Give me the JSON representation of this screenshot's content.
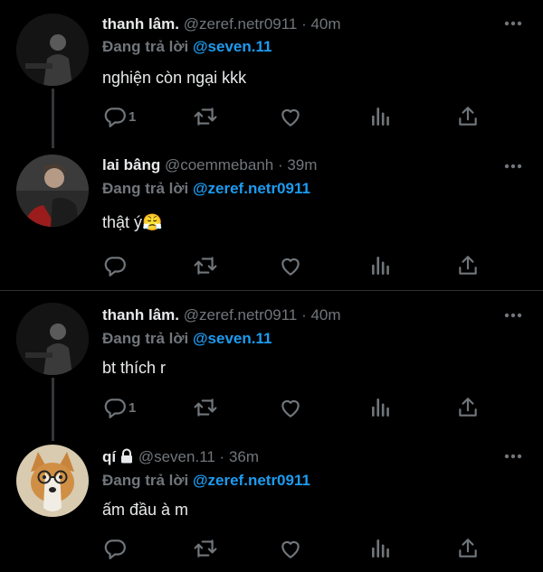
{
  "colors": {
    "background": "#000000",
    "text": "#e7e9ea",
    "muted": "#71767b",
    "accent": "#1d9bf0"
  },
  "reply_prefix": "Đang trả lời",
  "tweets": [
    {
      "name": "thanh lâm.",
      "handle": "@zeref.netr0911 · 40m",
      "reply_to": "@seven.11",
      "text": "nghiện còn ngại kkk",
      "reply_count": "1"
    },
    {
      "name": "lai bâng",
      "handle": "@coemmebanh · 39m",
      "reply_to": "@zeref.netr0911",
      "text": "thật ý😤",
      "reply_count": ""
    },
    {
      "name": "thanh lâm.",
      "handle": "@zeref.netr0911 · 40m",
      "reply_to": "@seven.11",
      "text": "bt thích r",
      "reply_count": "1"
    },
    {
      "name": "qí",
      "handle": "@seven.11 · 36m",
      "reply_to": "@zeref.netr0911",
      "text": "ấm đầu à m",
      "reply_count": ""
    }
  ],
  "icons": [
    "reply-icon",
    "retweet-icon",
    "like-icon",
    "views-icon",
    "share-icon",
    "more-icon",
    "lock-icon"
  ]
}
